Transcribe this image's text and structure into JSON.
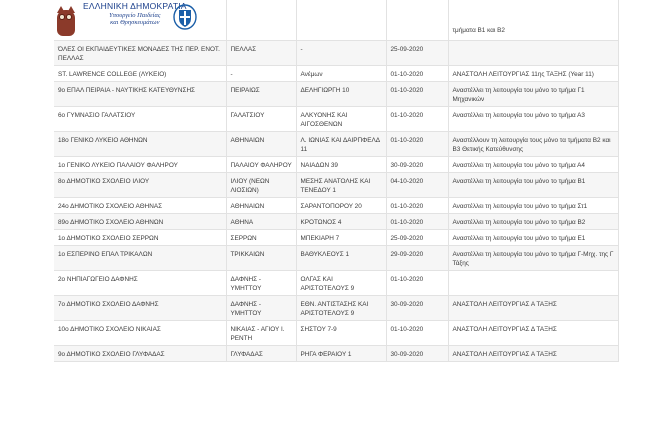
{
  "header": {
    "title": "ΕΛΛΗΝΙΚΗ ΔΗΜΟΚΡΑΤΙΑ",
    "subtitle_line1": "Υπουργείο Παιδείας",
    "subtitle_line2": "και Θρησκευμάτων"
  },
  "top_note": "τμήματα Β1 και Β2",
  "rows": [
    [
      "ΌΛΕΣ ΟΙ ΕΚΠΑΙΔΕΥΤΙΚΕΣ ΜΟΝΑΔΕΣ ΤΗΣ ΠΕΡ. ΕΝΟΤ. ΠΕΛΛΑΣ",
      "ΠΕΛΛΑΣ",
      "-",
      "25-09-2020",
      ""
    ],
    [
      "ST. LAWRENCE COLLEGE (ΛΥΚΕΙΟ)",
      "-",
      "Ανέμων",
      "01-10-2020",
      "ΑΝΑΣΤΟΛΗ ΛΕΙΤΟΥΡΓΙΑΣ 11ης ΤΑΞΗΣ (Year 11)"
    ],
    [
      "9ο ΕΠΑΛ ΠΕΙΡΑΙΑ - ΝΑΥΤΙΚΗΣ ΚΑΤΕΥΘΥΝΣΗΣ",
      "ΠΕΙΡΑΙΩΣ",
      "ΔΕΛΗΓΙΩΡΓΗ 10",
      "01-10-2020",
      "Αναστέλλει τη λειτουργία του μόνο το τμήμα Γ1 Μηχανικών"
    ],
    [
      "6ο ΓΥΜΝΑΣΙΟ ΓΑΛΑΤΣΙΟΥ",
      "ΓΑΛΑΤΣΙΟΥ",
      "ΑΛΚΥΟΝΗΣ ΚΑΙ ΑΙΓΟΣΘΕΝΩΝ",
      "01-10-2020",
      "Αναστέλλει τη λειτουργία του μόνο το τμήμα Α3"
    ],
    [
      "18ο ΓΕΝΙΚΟ ΛΥΚΕΙΟ ΑΘΗΝΩΝ",
      "ΑΘΗΝΑΙΩΝ",
      "Λ. ΙΩΝΙΑΣ ΚΑΙ ΔΑΙΡΠΦΕΛΔ 11",
      "01-10-2020",
      "Αναστέλλουν τη λειτουργία τους μόνο τα τμήματα Β2 και Β3 Θετικής Κατεύθυνσης"
    ],
    [
      "1ο ΓΕΝΙΚΟ ΛΥΚΕΙΟ ΠΑΛΑΙΟΥ ΦΑΛΗΡΟΥ",
      "ΠΑΛΑΙΟΥ ΦΑΛΗΡΟΥ",
      "ΝΑΙΑΔΩΝ 39",
      "30-09-2020",
      "Αναστέλλει τη λειτουργία του μόνο το τμήμα Α4"
    ],
    [
      "8ο ΔΗΜΟΤΙΚΟ ΣΧΟΛΕΙΟ ΙΛΙΟΥ",
      "ΙΛΙΟΥ (ΝΕΩΝ ΛΙΟΣΙΩΝ)",
      "ΜΕΣΗΣ ΑΝΑΤΟΛΗΣ ΚΑΙ ΤΕΝΕΔΟΥ 1",
      "04-10-2020",
      "Αναστέλλει τη λειτουργία του μόνο το τμήμα Β1"
    ],
    [
      "24ο ΔΗΜΟΤΙΚΟ ΣΧΟΛΕΙΟ ΑΘΗΝΑΣ",
      "ΑΘΗΝΑΙΩΝ",
      "ΣΑΡΑΝΤΟΠΟΡΟΥ 20",
      "01-10-2020",
      "Αναστέλλει τη λειτουργία του μόνο το τμήμα Στ1"
    ],
    [
      "89ο ΔΗΜΟΤΙΚΟ ΣΧΟΛΕΙΟ ΑΘΗΝΩΝ",
      "ΑΘΗΝΑ",
      "ΚΡΟΤΩΝΟΣ 4",
      "01-10-2020",
      "Αναστέλλει τη λειτουργία του μόνο το τμήμα Β2"
    ],
    [
      "1ο ΔΗΜΟΤΙΚΟ ΣΧΟΛΕΙΟ ΣΕΡΡΩΝ",
      "ΣΕΡΡΩΝ",
      "ΜΠΕΚΙΑΡΗ 7",
      "25-09-2020",
      "Αναστέλλει τη λειτουργία του μόνο το τμήμα Ε1"
    ],
    [
      "1ο ΕΣΠΕΡΙΝΟ ΕΠΑΛ ΤΡΙΚΑΛΩΝ",
      "ΤΡΙΚΚΑΙΩΝ",
      "ΒΑΘΥΚΛΕΟΥΣ 1",
      "29-09-2020",
      "Αναστέλλει τη λειτουργία του μόνο το τμήμα Γ-Μηχ. της Γ Τάξης"
    ],
    [
      "2ο ΝΗΠΙΑΓΩΓΕΙΟ ΔΑΦΝΗΣ",
      "ΔΑΦΝΗΣ - ΥΜΗΤΤΟΥ",
      "ΟΛΓΑΣ ΚΑΙ ΑΡΙΣΤΟΤΕΛΟΥΣ 9",
      "01-10-2020",
      ""
    ],
    [
      "7ο ΔΗΜΟΤΙΚΟ ΣΧΟΛΕΙΟ ΔΑΦΝΗΣ",
      "ΔΑΦΝΗΣ - ΥΜΗΤΤΟΥ",
      "ΕΘΝ. ΑΝΤΙΣΤΑΣΗΣ ΚΑΙ ΑΡΙΣΤΟΤΕΛΟΥΣ 9",
      "30-09-2020",
      "ΑΝΑΣΤΟΛΗ ΛΕΙΤΟΥΡΓΙΑΣ Α ΤΑΞΗΣ"
    ],
    [
      "10ο ΔΗΜΟΤΙΚΟ ΣΧΟΛΕΙΟ ΝΙΚΑΙΑΣ",
      "ΝΙΚΑΙΑΣ - ΑΓΙΟΥ Ι. ΡΕΝΤΗ",
      "ΣΗΣΤΟΥ 7-9",
      "01-10-2020",
      "ΑΝΑΣΤΟΛΗ ΛΕΙΤΟΥΡΓΙΑΣ Δ ΤΑΞΗΣ"
    ],
    [
      "9ο ΔΗΜΟΤΙΚΟ ΣΧΟΛΕΙΟ ΓΛΥΦΑΔΑΣ",
      "ΓΛΥΦΑΔΑΣ",
      "ΡΗΓΑ ΦΕΡΑΙΟΥ 1",
      "30-09-2020",
      "ΑΝΑΣΤΟΛΗ ΛΕΙΤΟΥΡΓΙΑΣ Α ΤΑΞΗΣ"
    ]
  ]
}
